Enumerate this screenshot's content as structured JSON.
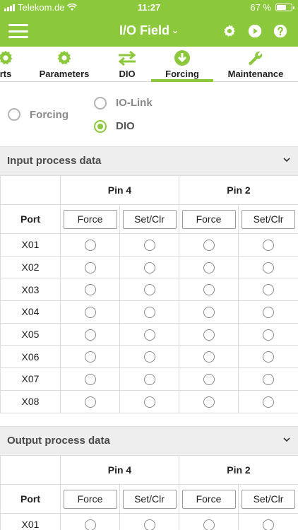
{
  "status_bar": {
    "carrier": "Telekom.de",
    "time": "11:27",
    "battery": "67 %",
    "battery_level": 0.67
  },
  "header": {
    "title": "I/O Field",
    "chevron": "⌄",
    "icons": [
      "menu-icon",
      "settings-sync-icon",
      "play-icon",
      "help-icon"
    ]
  },
  "tabs": [
    {
      "label": "rts",
      "icon": "gear-icon"
    },
    {
      "label": "Parameters",
      "icon": "gear-icon"
    },
    {
      "label": "DIO",
      "icon": "swap-arrows-icon"
    },
    {
      "label": "Forcing",
      "icon": "download-arrow-icon",
      "active": true
    },
    {
      "label": "Maintenance",
      "icon": "wrench-icon"
    }
  ],
  "mode": {
    "forcing": "Forcing",
    "iolink": "IO-Link",
    "dio": "DIO",
    "selected": "DIO"
  },
  "input_section": {
    "title": "Input process data",
    "port_label": "Port",
    "pins": [
      "Pin 4",
      "Pin 2"
    ],
    "force_label": "Force",
    "setclr_label": "Set/Clr",
    "ports": [
      "X01",
      "X02",
      "X03",
      "X04",
      "X05",
      "X06",
      "X07",
      "X08"
    ]
  },
  "output_section": {
    "title": "Output process data",
    "port_label": "Port",
    "pins": [
      "Pin 4",
      "Pin 2"
    ],
    "force_label": "Force",
    "setclr_label": "Set/Clr",
    "ports": [
      "X01"
    ]
  },
  "colors": {
    "accent": "#8cc83c",
    "section_bg": "#eeeeef",
    "border": "#dcdcdc"
  }
}
